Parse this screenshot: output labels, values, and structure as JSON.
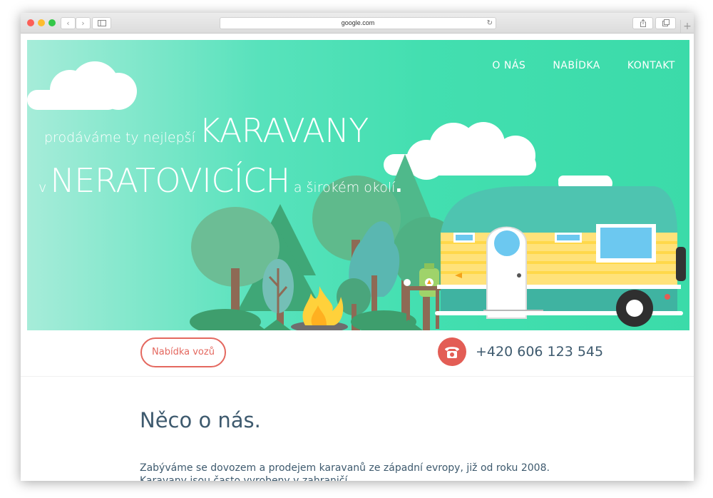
{
  "browser": {
    "url": "google.com",
    "back_icon": "chevron-left-icon",
    "forward_icon": "chevron-right-icon",
    "sidebar_icon": "sidebar-icon",
    "reload_icon": "reload-icon",
    "share_icon": "share-icon",
    "tabs_icon": "tabs-icon",
    "new_tab_icon": "plus-icon"
  },
  "nav": {
    "items": [
      {
        "label": "O NÁS"
      },
      {
        "label": "NABÍDKA"
      },
      {
        "label": "KONTAKT"
      }
    ]
  },
  "hero": {
    "line1_small": "prodáváme ty nejlepší",
    "line1_big": "KARAVANY",
    "line2_prefix": "v",
    "line2_big": "NERATOVICÍCH",
    "line2_suffix": "a širokém okolí",
    "line2_dot": "."
  },
  "band": {
    "offer_button": "Nabídka vozů",
    "phone_icon": "telephone-icon",
    "phone_number": "+420 606 123 545"
  },
  "about": {
    "title": "Něco o nás.",
    "text": "Zabýváme se dovozem a prodejem karavanů ze západní evropy,  již od roku 2008. Karavany jsou často vyrobeny v zahraničí."
  },
  "colors": {
    "hero_green": "#43dfb0",
    "accent_red": "#e4685f",
    "text_dark": "#3e5a6e"
  }
}
